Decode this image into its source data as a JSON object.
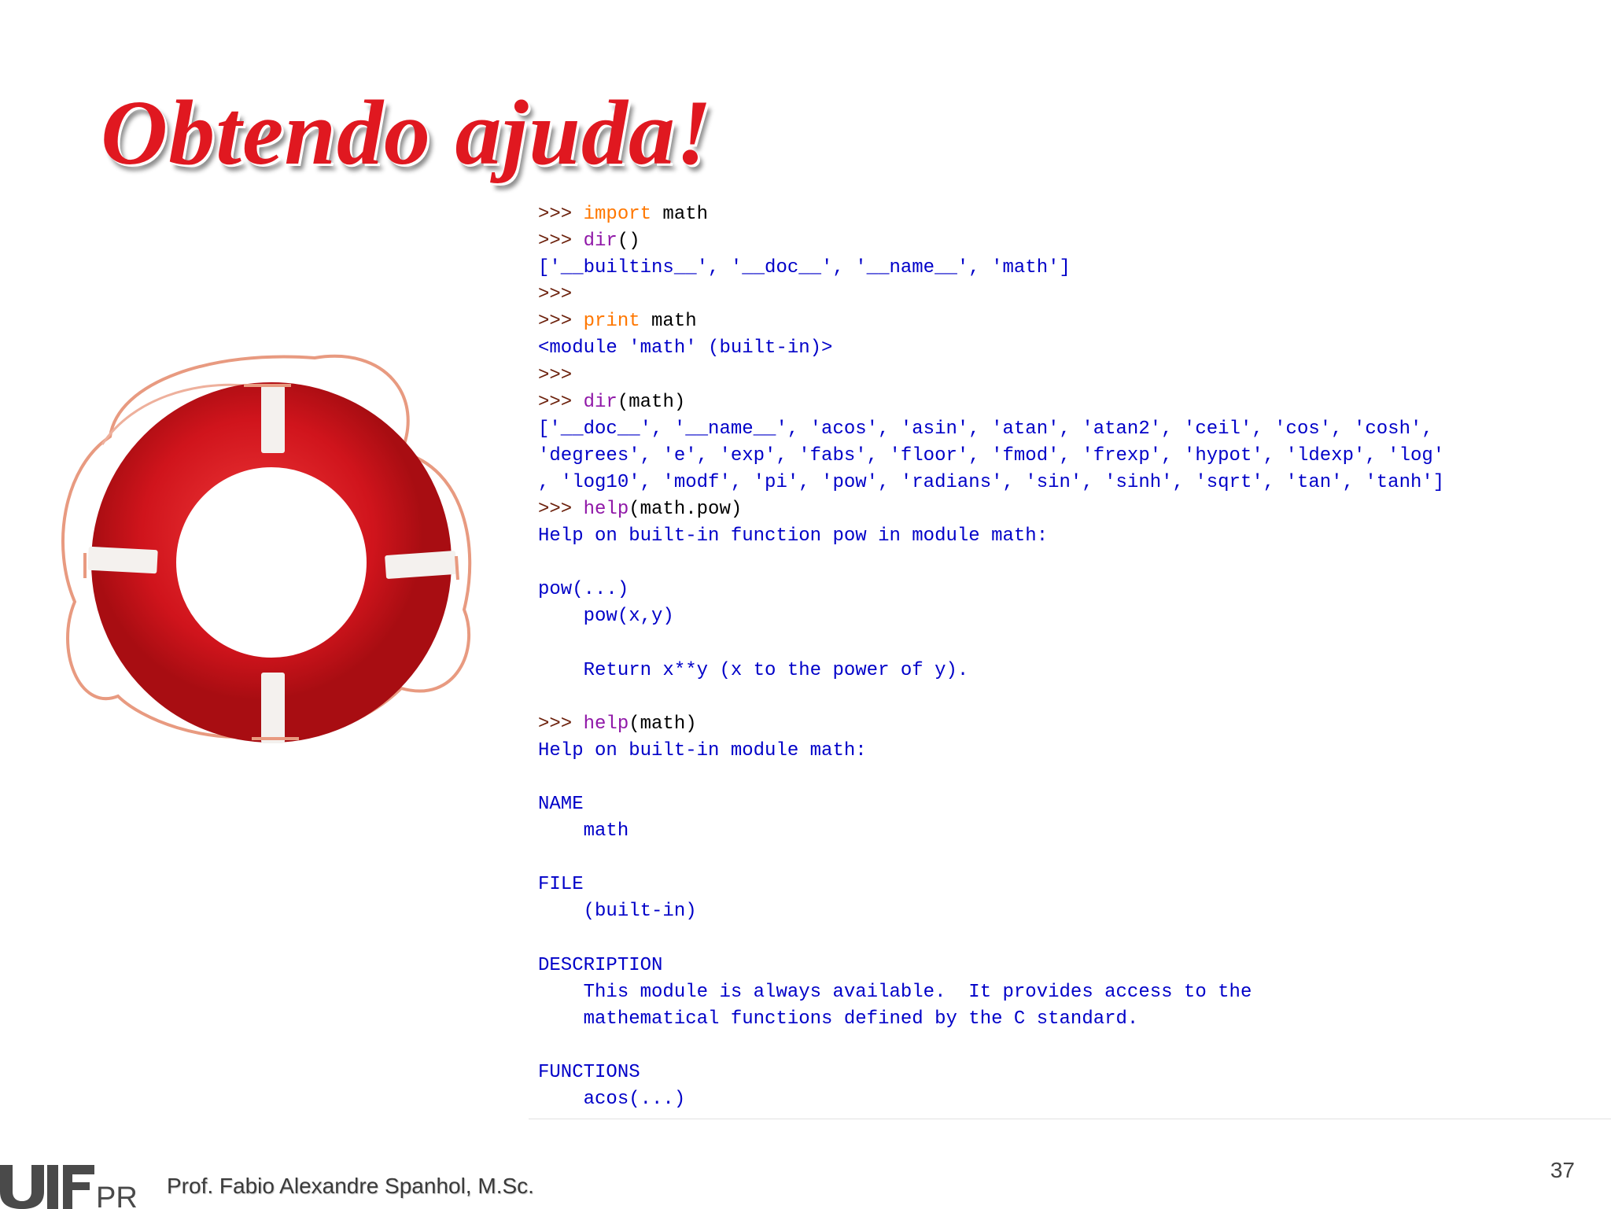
{
  "slide": {
    "title": "Obtendo ajuda!",
    "author": "Prof. Fabio Alexandre Spanhol, M.Sc.",
    "page_number": "37",
    "logo_text": "UTFPR"
  },
  "colors": {
    "title": "#e01820",
    "prompt": "#6b1f0a",
    "keyword_orange": "#ff7700",
    "keyword_purple": "#9018a8",
    "output": "#0000c8",
    "buoy_red": "#d0141c"
  },
  "icons": {
    "lifebuoy": "lifebuoy-icon",
    "logo": "utfpr-logo"
  },
  "console": {
    "lines": [
      [
        {
          "t": ">>> ",
          "c": "prompt"
        },
        {
          "t": "import",
          "c": "kw-orange"
        },
        {
          "t": " math",
          "c": "plain"
        }
      ],
      [
        {
          "t": ">>> ",
          "c": "prompt"
        },
        {
          "t": "dir",
          "c": "kw-purple"
        },
        {
          "t": "()",
          "c": "plain"
        }
      ],
      [
        {
          "t": "['__builtins__', '__doc__', '__name__', 'math']",
          "c": "out"
        }
      ],
      [
        {
          "t": ">>>",
          "c": "prompt"
        }
      ],
      [
        {
          "t": ">>> ",
          "c": "prompt"
        },
        {
          "t": "print",
          "c": "kw-orange"
        },
        {
          "t": " math",
          "c": "plain"
        }
      ],
      [
        {
          "t": "<module 'math' (built-in)>",
          "c": "out"
        }
      ],
      [
        {
          "t": ">>>",
          "c": "prompt"
        }
      ],
      [
        {
          "t": ">>> ",
          "c": "prompt"
        },
        {
          "t": "dir",
          "c": "kw-purple"
        },
        {
          "t": "(math)",
          "c": "plain"
        }
      ],
      [
        {
          "t": "['__doc__', '__name__', 'acos', 'asin', 'atan', 'atan2', 'ceil', 'cos', 'cosh',",
          "c": "out"
        }
      ],
      [
        {
          "t": "'degrees', 'e', 'exp', 'fabs', 'floor', 'fmod', 'frexp', 'hypot', 'ldexp', 'log'",
          "c": "out"
        }
      ],
      [
        {
          "t": ", 'log10', 'modf', 'pi', 'pow', 'radians', 'sin', 'sinh', 'sqrt', 'tan', 'tanh']",
          "c": "out"
        }
      ],
      [
        {
          "t": ">>> ",
          "c": "prompt"
        },
        {
          "t": "help",
          "c": "kw-purple"
        },
        {
          "t": "(math.pow)",
          "c": "plain"
        }
      ],
      [
        {
          "t": "Help on built-in function pow in module math:",
          "c": "out"
        }
      ],
      [
        {
          "t": "",
          "c": "out"
        }
      ],
      [
        {
          "t": "pow(...)",
          "c": "out"
        }
      ],
      [
        {
          "t": "    pow(x,y)",
          "c": "out"
        }
      ],
      [
        {
          "t": "",
          "c": "out"
        }
      ],
      [
        {
          "t": "    Return x**y (x to the power of y).",
          "c": "out"
        }
      ],
      [
        {
          "t": "",
          "c": "out"
        }
      ],
      [
        {
          "t": ">>> ",
          "c": "prompt"
        },
        {
          "t": "help",
          "c": "kw-purple"
        },
        {
          "t": "(math)",
          "c": "plain"
        }
      ],
      [
        {
          "t": "Help on built-in module math:",
          "c": "out"
        }
      ],
      [
        {
          "t": "",
          "c": "out"
        }
      ],
      [
        {
          "t": "NAME",
          "c": "out"
        }
      ],
      [
        {
          "t": "    math",
          "c": "out"
        }
      ],
      [
        {
          "t": "",
          "c": "out"
        }
      ],
      [
        {
          "t": "FILE",
          "c": "out"
        }
      ],
      [
        {
          "t": "    (built-in)",
          "c": "out"
        }
      ],
      [
        {
          "t": "",
          "c": "out"
        }
      ],
      [
        {
          "t": "DESCRIPTION",
          "c": "out"
        }
      ],
      [
        {
          "t": "    This module is always available.  It provides access to the",
          "c": "out"
        }
      ],
      [
        {
          "t": "    mathematical functions defined by the C standard.",
          "c": "out"
        }
      ],
      [
        {
          "t": "",
          "c": "out"
        }
      ],
      [
        {
          "t": "FUNCTIONS",
          "c": "out"
        }
      ],
      [
        {
          "t": "    acos(...)",
          "c": "out"
        }
      ]
    ]
  }
}
